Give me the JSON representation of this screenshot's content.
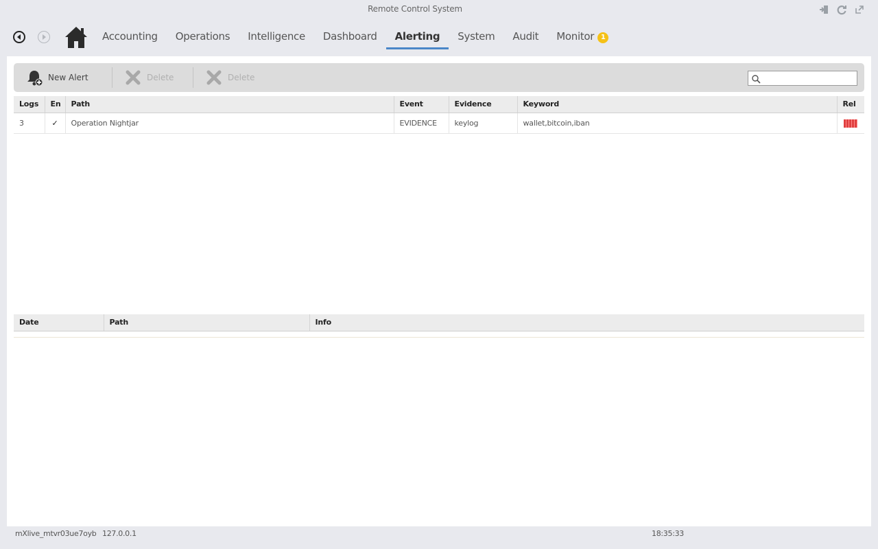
{
  "window": {
    "title": "Remote Control System",
    "controls": [
      {
        "icon": "logout-icon"
      },
      {
        "icon": "refresh-icon"
      },
      {
        "icon": "popout-icon"
      }
    ]
  },
  "nav": {
    "back_icon": "back-arrow-icon",
    "forward_icon": "forward-arrow-icon",
    "home_icon": "home-icon",
    "tabs": [
      {
        "label": "Accounting",
        "active": false
      },
      {
        "label": "Operations",
        "active": false
      },
      {
        "label": "Intelligence",
        "active": false
      },
      {
        "label": "Dashboard",
        "active": false
      },
      {
        "label": "Alerting",
        "active": true
      },
      {
        "label": "System",
        "active": false
      },
      {
        "label": "Audit",
        "active": false
      },
      {
        "label": "Monitor",
        "active": false,
        "badge": "1"
      }
    ],
    "accent_color": "#4a86c8",
    "badge_color": "#f5c117"
  },
  "toolbar": {
    "new_alert_label": "New Alert",
    "delete_label": "Delete",
    "delete2_label": "Delete",
    "search_placeholder": ""
  },
  "alerts_table": {
    "columns": [
      "Logs",
      "En",
      "Path",
      "Event",
      "Evidence",
      "Keyword",
      "Rel"
    ],
    "rows": [
      {
        "logs": "3",
        "enabled": "✓",
        "path": "Operation Nightjar",
        "event": "EVIDENCE",
        "evidence": "keylog",
        "keyword": "wallet,bitcoin,iban",
        "relevance_icon": "relevance-bar-icon",
        "relevance_color": "#e04040"
      }
    ]
  },
  "logs_table": {
    "columns": [
      "Date",
      "Path",
      "Info"
    ],
    "rows": []
  },
  "status": {
    "user": "mXlive_mtvr03ue7oyb",
    "ip": "127.0.0.1",
    "time": "18:35:33"
  }
}
